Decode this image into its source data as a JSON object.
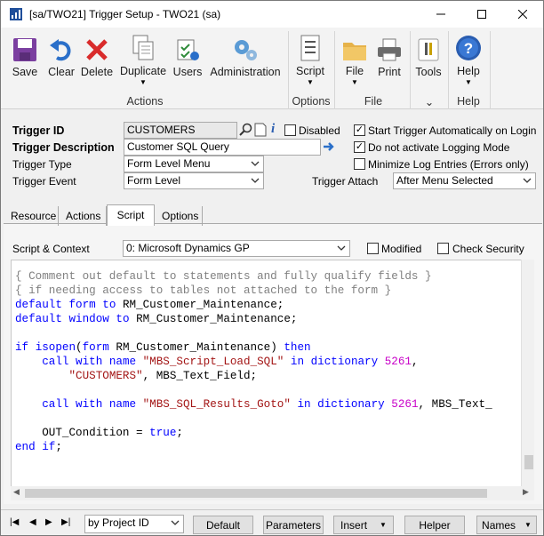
{
  "window": {
    "title": "[sa/TWO21] Trigger Setup  -  TWO21 (sa)"
  },
  "ribbon": {
    "buttons": [
      {
        "id": "save",
        "label": "Save"
      },
      {
        "id": "clear",
        "label": "Clear"
      },
      {
        "id": "delete",
        "label": "Delete"
      },
      {
        "id": "duplicate",
        "label": "Duplicate"
      },
      {
        "id": "users",
        "label": "Users"
      },
      {
        "id": "administration",
        "label": "Administration"
      },
      {
        "id": "script",
        "label": "Script"
      },
      {
        "id": "file",
        "label": "File"
      },
      {
        "id": "print",
        "label": "Print"
      },
      {
        "id": "tools",
        "label": "Tools"
      },
      {
        "id": "help",
        "label": "Help"
      }
    ],
    "groups": {
      "actions": "Actions",
      "options": "Options",
      "file": "File",
      "help": "Help"
    }
  },
  "form": {
    "trigger_id_label": "Trigger ID",
    "trigger_id_value": "CUSTOMERS",
    "disabled_label": "Disabled",
    "disabled_checked": false,
    "trigger_desc_label": "Trigger Description",
    "trigger_desc_value": "Customer SQL Query",
    "trigger_type_label": "Trigger Type",
    "trigger_type_value": "Form Level Menu",
    "trigger_event_label": "Trigger Event",
    "trigger_event_value": "Form Level",
    "start_auto_label": "Start Trigger Automatically on Login",
    "start_auto_checked": true,
    "no_logging_label": "Do not activate Logging Mode",
    "no_logging_checked": true,
    "minimize_log_label": "Minimize Log Entries (Errors only)",
    "minimize_log_checked": false,
    "trigger_attach_label": "Trigger Attach",
    "trigger_attach_value": "After Menu Selected"
  },
  "tabs": [
    {
      "label": "Resource",
      "active": false
    },
    {
      "label": "Actions",
      "active": false
    },
    {
      "label": "Script",
      "active": true
    },
    {
      "label": "Options",
      "active": false
    }
  ],
  "script": {
    "context_label": "Script & Context",
    "context_value": "0: Microsoft Dynamics GP",
    "modified_label": "Modified",
    "modified_checked": false,
    "check_security_label": "Check Security",
    "check_security_checked": false,
    "lines": [
      "{ Comment out default to statements and fully qualify fields }",
      "{ if needing access to tables not attached to the form }",
      "default form to RM_Customer_Maintenance;",
      "default window to RM_Customer_Maintenance;",
      "",
      "if isopen(form RM_Customer_Maintenance) then",
      "    call with name \"MBS_Script_Load_SQL\" in dictionary 5261,",
      "        \"CUSTOMERS\", MBS_Text_Field;",
      "",
      "    call with name \"MBS_SQL_Results_Goto\" in dictionary 5261, MBS_Text_",
      "",
      "    OUT_Condition = true;",
      "end if;"
    ]
  },
  "bottom": {
    "sort_value": "by Project ID",
    "default_label": "Default",
    "parameters_label": "Parameters",
    "insert_label": "Insert",
    "helper_label": "Helper",
    "names_label": "Names"
  }
}
